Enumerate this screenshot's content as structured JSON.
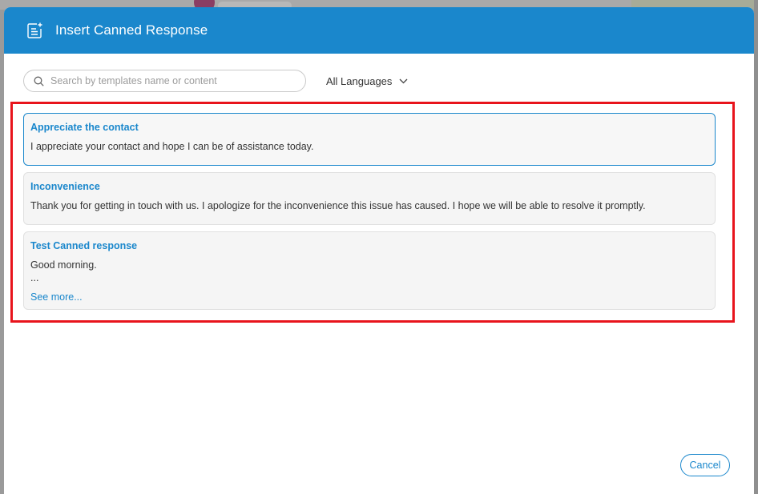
{
  "dialog": {
    "title": "Insert Canned Response",
    "icon": "note-add-icon"
  },
  "search": {
    "placeholder": "Search by templates name or content",
    "value": ""
  },
  "language_filter": {
    "selected": "All Languages"
  },
  "responses": [
    {
      "title": "Appreciate the contact",
      "body": "I appreciate your contact and hope I can be of assistance today.",
      "selected": true
    },
    {
      "title": "Inconvenience",
      "body": "Thank you for getting in touch with us. I apologize for the inconvenience this issue has caused. I hope we will be able to resolve it promptly.",
      "selected": false
    },
    {
      "title": "Test Canned response",
      "body": "Good morning.",
      "ellipsis": "...",
      "see_more": "See more...",
      "selected": false
    }
  ],
  "footer": {
    "cancel_label": "Cancel"
  },
  "colors": {
    "accent": "#1a87cc",
    "highlight": "#e8141c"
  }
}
